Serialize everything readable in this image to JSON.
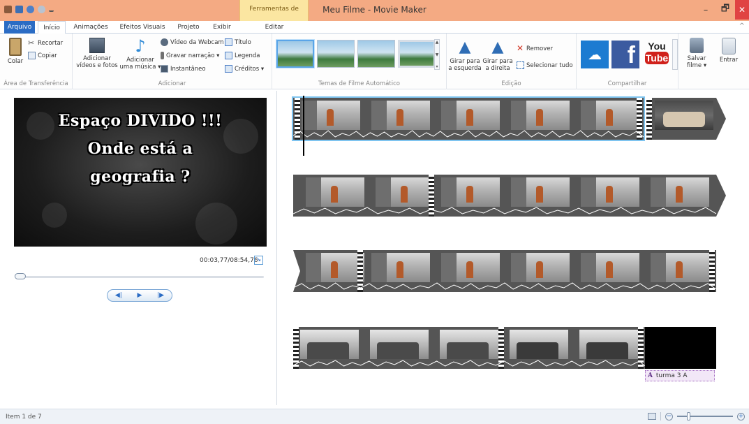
{
  "window": {
    "title": "Meu Filme - Movie Maker",
    "tool_tab_header": "Ferramentas de Vídeo",
    "minimize": "–",
    "maximize": "🗗",
    "close": "✕"
  },
  "tabs": [
    {
      "label": "Arquivo"
    },
    {
      "label": "Início"
    },
    {
      "label": "Animações"
    },
    {
      "label": "Efeitos Visuais"
    },
    {
      "label": "Projeto"
    },
    {
      "label": "Exibir"
    },
    {
      "label": "Editar"
    }
  ],
  "ribbon": {
    "clipboard": {
      "label": "Área de Transferência",
      "paste": "Colar",
      "cut": "Recortar",
      "copy": "Copiar"
    },
    "add": {
      "label": "Adicionar",
      "add_videos_1": "Adicionar",
      "add_videos_2": "vídeos e fotos",
      "add_music_1": "Adicionar",
      "add_music_2": "uma música ▾",
      "webcam": "Vídeo da Webcam",
      "narration": "Gravar narração ▾",
      "snapshot": "Instantâneo",
      "title": "Título",
      "caption": "Legenda",
      "credits": "Créditos ▾"
    },
    "themes": {
      "label": "Temas de Filme Automático"
    },
    "editing": {
      "label": "Edição",
      "rotate_left_1": "Girar para",
      "rotate_left_2": "a esquerda",
      "rotate_right_1": "Girar para",
      "rotate_right_2": "a direita",
      "remove": "Remover",
      "select_all": "Selecionar tudo"
    },
    "share": {
      "label": "Compartilhar",
      "youtube_1": "You",
      "youtube_2": "Tube",
      "facebook": "f",
      "save_1": "Salvar",
      "save_2": "filme ▾",
      "signin": "Entrar"
    }
  },
  "preview": {
    "line1": "Espaço DIVIDO !!!",
    "line2": "Onde está a",
    "line3": "geografia ?",
    "timecode": "00:03,77/08:54,76"
  },
  "storyboard": {
    "caption": "turma 3 A",
    "caption_icon": "A"
  },
  "status": {
    "item": "Item 1 de 7"
  },
  "colors": {
    "titlebar": "#f4aa83",
    "file_tab": "#2b6cc4",
    "tool_tab": "#fbe6a1",
    "close": "#e04343"
  }
}
